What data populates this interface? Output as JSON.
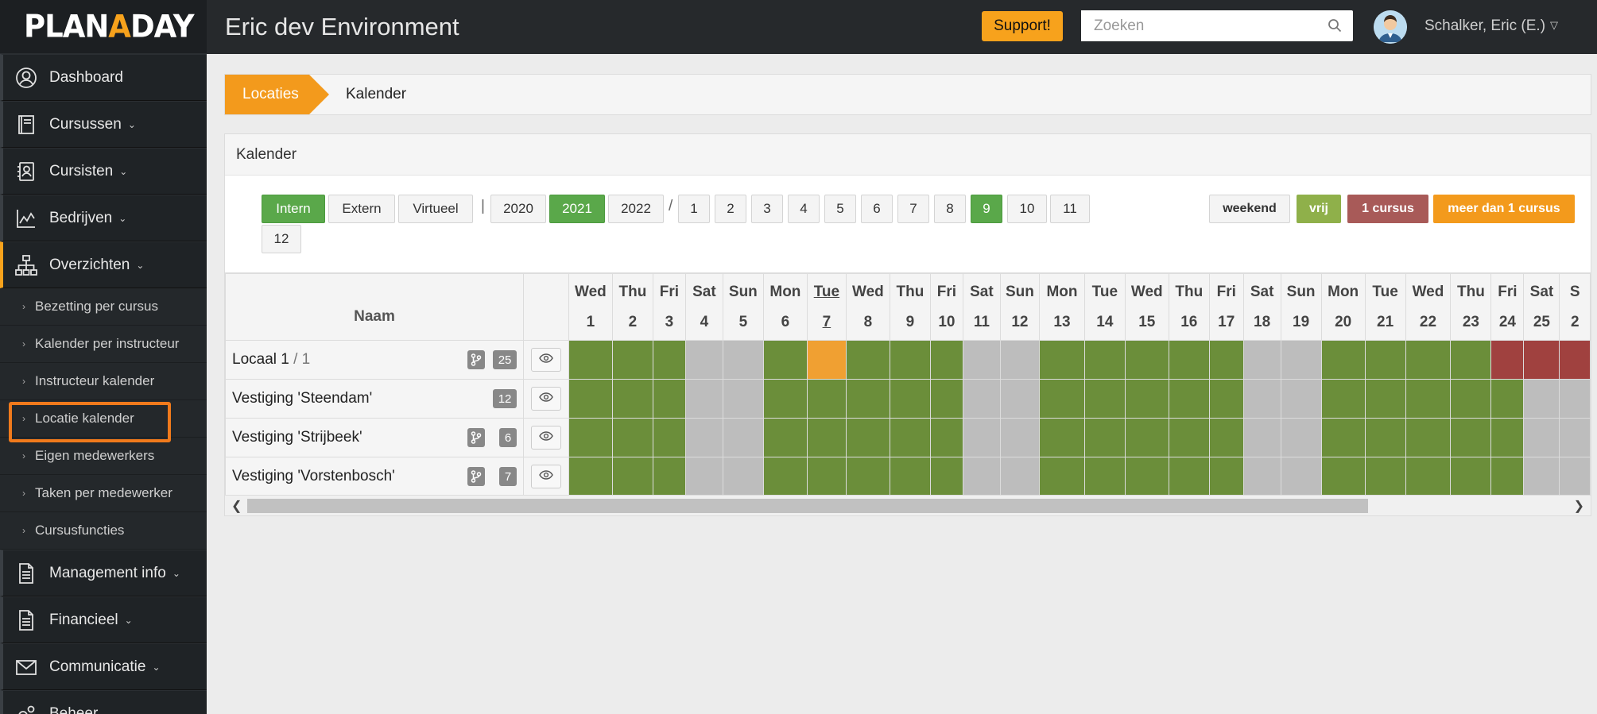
{
  "brand": {
    "logo_pre": "PLAN",
    "logo_accent": "A",
    "logo_post": "DAY",
    "accent_color": "#f7a21c"
  },
  "topbar": {
    "env_title": "Eric dev Environment",
    "support_label": "Support!",
    "search_placeholder": "Zoeken",
    "user_name": "Schalker, Eric (E.)"
  },
  "sidebar": {
    "items": [
      {
        "label": "Dashboard",
        "icon": "user-circle-icon"
      },
      {
        "label": "Cursussen",
        "icon": "book-icon"
      },
      {
        "label": "Cursisten",
        "icon": "contacts-icon"
      },
      {
        "label": "Bedrijven",
        "icon": "chart-icon"
      },
      {
        "label": "Overzichten",
        "icon": "sitemap-icon"
      }
    ],
    "sub_items": [
      "Bezetting per cursus",
      "Kalender per instructeur",
      "Instructeur kalender",
      "Locatie kalender",
      "Eigen medewerkers",
      "Taken per medewerker",
      "Cursusfuncties"
    ],
    "bottom_items": [
      {
        "label": "Management info",
        "icon": "document-icon"
      },
      {
        "label": "Financieel",
        "icon": "document-icon"
      },
      {
        "label": "Communicatie",
        "icon": "envelope-icon"
      },
      {
        "label": "Beheer",
        "icon": "gears-icon"
      }
    ]
  },
  "breadcrumb": {
    "first": "Locaties",
    "second": "Kalender"
  },
  "panel": {
    "title": "Kalender",
    "types": [
      "Intern",
      "Extern",
      "Virtueel"
    ],
    "years": [
      "2020",
      "2021",
      "2022"
    ],
    "months": [
      "1",
      "2",
      "3",
      "4",
      "5",
      "6",
      "7",
      "8",
      "9",
      "10",
      "11",
      "12"
    ],
    "selected_type": "Intern",
    "selected_year": "2021",
    "selected_month": "9",
    "legend": [
      {
        "label": "weekend",
        "bg": "#f4f4f4",
        "fg": "#333"
      },
      {
        "label": "vrij",
        "bg": "#8fb04a",
        "fg": "#ffffff"
      },
      {
        "label": "1 cursus",
        "bg": "#a85a58",
        "fg": "#ffffff"
      },
      {
        "label": "meer dan 1 cursus",
        "bg": "#f39a1c",
        "fg": "#ffffff"
      }
    ]
  },
  "grid": {
    "naam_header": "Naam",
    "days": [
      {
        "d": "Wed",
        "n": "1"
      },
      {
        "d": "Thu",
        "n": "2"
      },
      {
        "d": "Fri",
        "n": "3"
      },
      {
        "d": "Sat",
        "n": "4"
      },
      {
        "d": "Sun",
        "n": "5"
      },
      {
        "d": "Mon",
        "n": "6"
      },
      {
        "d": "Tue",
        "n": "7"
      },
      {
        "d": "Wed",
        "n": "8"
      },
      {
        "d": "Thu",
        "n": "9"
      },
      {
        "d": "Fri",
        "n": "10"
      },
      {
        "d": "Sat",
        "n": "11"
      },
      {
        "d": "Sun",
        "n": "12"
      },
      {
        "d": "Mon",
        "n": "13"
      },
      {
        "d": "Tue",
        "n": "14"
      },
      {
        "d": "Wed",
        "n": "15"
      },
      {
        "d": "Thu",
        "n": "16"
      },
      {
        "d": "Fri",
        "n": "17"
      },
      {
        "d": "Sat",
        "n": "18"
      },
      {
        "d": "Sun",
        "n": "19"
      },
      {
        "d": "Mon",
        "n": "20"
      },
      {
        "d": "Tue",
        "n": "21"
      },
      {
        "d": "Wed",
        "n": "22"
      },
      {
        "d": "Thu",
        "n": "23"
      },
      {
        "d": "Fri",
        "n": "24"
      },
      {
        "d": "Sat",
        "n": "25"
      },
      {
        "d": "S",
        "n": "2"
      }
    ],
    "today_index": 6,
    "rows": [
      {
        "name": "Locaal 1",
        "suffix": " / 1",
        "branch": true,
        "count": "25",
        "cells": "vvvwwvmvvvwwvvvvvwwvvvvooo"
      },
      {
        "name": "Vestiging 'Steendam'",
        "suffix": "",
        "branch": false,
        "count": "12",
        "cells": "vvvwwvvvvvwwvvvvvwwvvvvvww"
      },
      {
        "name": "Vestiging 'Strijbeek'",
        "suffix": "",
        "branch": true,
        "count": "6",
        "cells": "vvvwwvvvvvwwvvvvvwwvvvvvww"
      },
      {
        "name": "Vestiging 'Vorstenbosch'",
        "suffix": "",
        "branch": true,
        "count": "7",
        "cells": "vvvwwvvvvvwwvvvvvwwvvvvvww"
      }
    ]
  }
}
